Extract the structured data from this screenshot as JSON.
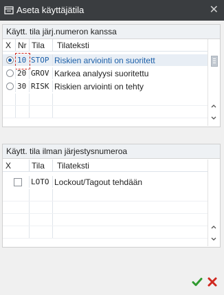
{
  "window": {
    "title": "Aseta käyttäjätila",
    "close_glyph": "✕"
  },
  "panel1": {
    "header": "Käytt. tila järj.numeron kanssa",
    "columns": [
      "X",
      "Nr",
      "Tila",
      "Tilateksti"
    ],
    "rows": [
      {
        "nr": "10",
        "tila": "STOP",
        "text": "Riskien arviointi on suoritett",
        "selected": true
      },
      {
        "nr": "20",
        "tila": "GROV",
        "text": "Karkea analyysi suoritettu",
        "selected": false
      },
      {
        "nr": "30",
        "tila": "RISK",
        "text": "Riskien arviointi on tehty",
        "selected": false
      }
    ]
  },
  "panel2": {
    "header": "Käytt. tila ilman järjestysnumeroa",
    "columns": [
      "X",
      "Tila",
      "Tilateksti"
    ],
    "rows": [
      {
        "tila": "LOTO",
        "text": "Lockout/Tagout tehdään",
        "checked": false
      }
    ]
  },
  "icons": {
    "window": "window-icon",
    "confirm": "checkmark-icon",
    "cancel": "cancel-x-icon"
  },
  "colors": {
    "titlebar": "#3a3d40",
    "selected_row": "#e8eef5",
    "link_text": "#1c5fa8",
    "confirm": "#2f9a2f",
    "cancel": "#d0281f"
  }
}
